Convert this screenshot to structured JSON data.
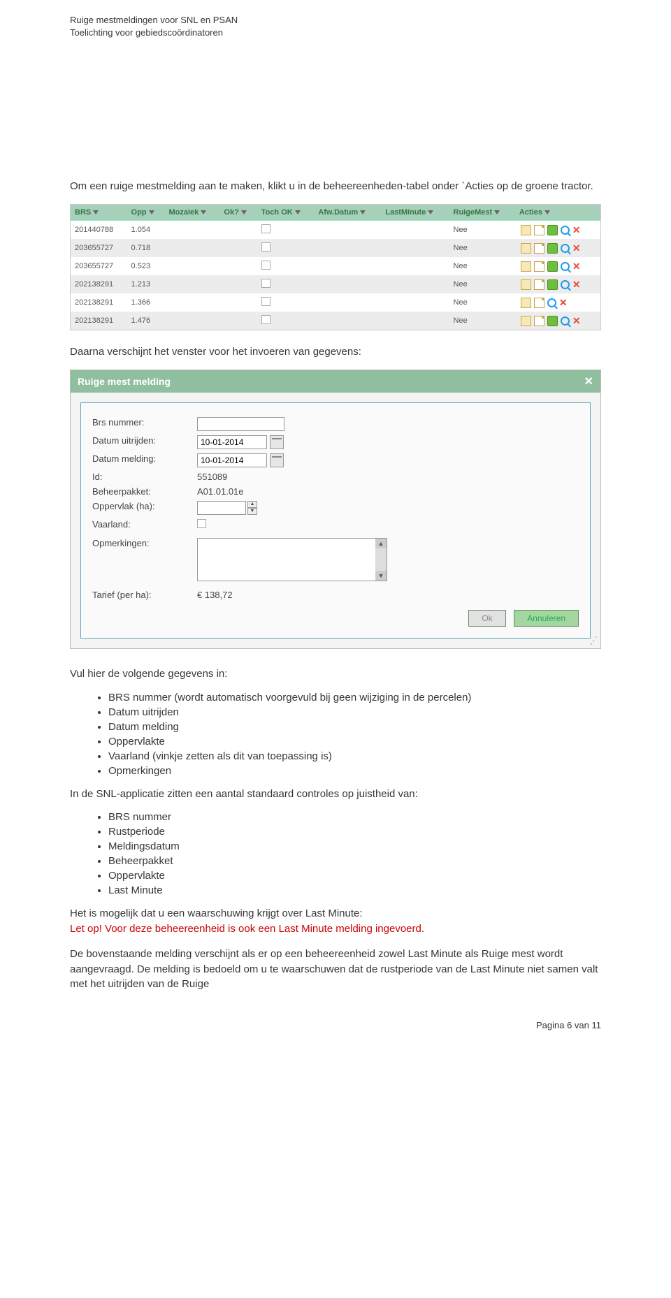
{
  "header": {
    "line1": "Ruige mestmeldingen voor SNL en PSAN",
    "line2": "Toelichting voor gebiedscoördinatoren"
  },
  "intro": "Om een ruige mestmelding aan te maken, klikt u in de beheereenheden-tabel onder `Acties op de groene tractor.",
  "table": {
    "headers": [
      "BRS",
      "Opp",
      "Mozaiek",
      "Ok?",
      "Toch OK",
      "Afw.Datum",
      "LastMinute",
      "RuigeMest",
      "Acties"
    ],
    "rows": [
      {
        "brs": "201440788",
        "opp": "1.054",
        "ruige": "Nee",
        "tractor": true
      },
      {
        "brs": "203655727",
        "opp": "0.718",
        "ruige": "Nee",
        "tractor": true
      },
      {
        "brs": "203655727",
        "opp": "0.523",
        "ruige": "Nee",
        "tractor": true
      },
      {
        "brs": "202138291",
        "opp": "1.213",
        "ruige": "Nee",
        "tractor": true
      },
      {
        "brs": "202138291",
        "opp": "1.366",
        "ruige": "Nee",
        "tractor": false
      },
      {
        "brs": "202138291",
        "opp": "1.476",
        "ruige": "Nee",
        "tractor": true
      }
    ]
  },
  "para2": "Daarna verschijnt het venster voor het invoeren van gegevens:",
  "dialog": {
    "title": "Ruige mest melding",
    "fields": {
      "brs_label": "Brs nummer:",
      "uit_label": "Datum uitrijden:",
      "uit_value": "10-01-2014",
      "meld_label": "Datum melding:",
      "meld_value": "10-01-2014",
      "id_label": "Id:",
      "id_value": "551089",
      "pakket_label": "Beheerpakket:",
      "pakket_value": "A01.01.01e",
      "opp_label": "Oppervlak (ha):",
      "vaar_label": "Vaarland:",
      "opm_label": "Opmerkingen:",
      "tarief_label": "Tarief (per ha):",
      "tarief_value": "€ 138,72"
    },
    "ok_label": "Ok",
    "cancel_label": "Annuleren"
  },
  "para3": "Vul hier de volgende gegevens in:",
  "list1": [
    "BRS nummer (wordt automatisch voorgevuld bij geen wijziging in de percelen)",
    "Datum uitrijden",
    "Datum melding",
    "Oppervlakte",
    "Vaarland (vinkje zetten als dit van toepassing is)",
    "Opmerkingen"
  ],
  "para4": "In de SNL-applicatie zitten een aantal standaard controles op juistheid van:",
  "list2": [
    "BRS nummer",
    "Rustperiode",
    "Meldingsdatum",
    "Beheerpakket",
    "Oppervlakte",
    "Last Minute"
  ],
  "warn1": "Het is mogelijk dat u een waarschuwing krijgt over Last Minute:",
  "warn2": "Let op! Voor deze beheereenheid is ook een Last Minute melding ingevoerd.",
  "para5": "De bovenstaande melding verschijnt als er op een beheereenheid zowel Last Minute als Ruige mest wordt aangevraagd. De melding is bedoeld om u te waarschuwen dat de rustperiode van de Last Minute niet samen valt met het uitrijden van de Ruige",
  "footer": "Pagina 6 van 11"
}
